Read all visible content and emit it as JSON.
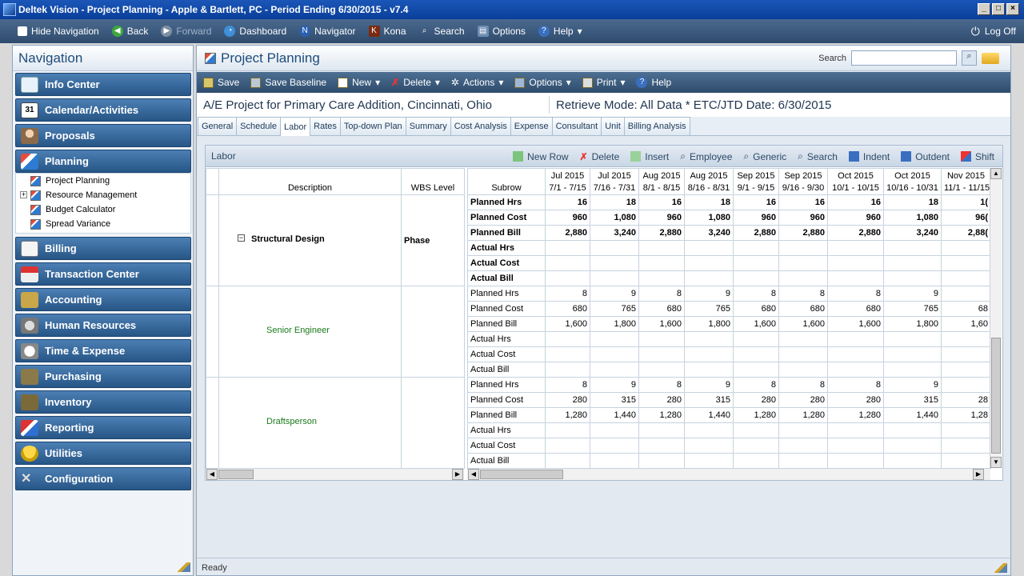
{
  "window": {
    "title": "Deltek Vision - Project Planning - Apple & Bartlett, PC - Period Ending 6/30/2015 - v7.4",
    "buttons": [
      "_",
      "□",
      "×"
    ]
  },
  "mainbar": {
    "hide_navigation": "Hide Navigation",
    "back": "Back",
    "forward": "Forward",
    "dashboard": "Dashboard",
    "navigator": "Navigator",
    "kona": "Kona",
    "search": "Search",
    "options": "Options",
    "help": "Help",
    "log_off": "Log Off"
  },
  "navigation": {
    "title": "Navigation",
    "items": [
      {
        "label": "Info Center",
        "icon": "info-center-icon"
      },
      {
        "label": "Calendar/Activities",
        "icon": "calendar-icon"
      },
      {
        "label": "Proposals",
        "icon": "proposals-icon"
      },
      {
        "label": "Planning",
        "icon": "planning-icon"
      },
      {
        "label": "Billing",
        "icon": "billing-icon"
      },
      {
        "label": "Transaction Center",
        "icon": "transaction-center-icon"
      },
      {
        "label": "Accounting",
        "icon": "accounting-icon"
      },
      {
        "label": "Human Resources",
        "icon": "human-resources-icon"
      },
      {
        "label": "Time & Expense",
        "icon": "time-expense-icon"
      },
      {
        "label": "Purchasing",
        "icon": "purchasing-icon"
      },
      {
        "label": "Inventory",
        "icon": "inventory-icon"
      },
      {
        "label": "Reporting",
        "icon": "reporting-icon"
      },
      {
        "label": "Utilities",
        "icon": "utilities-icon"
      },
      {
        "label": "Configuration",
        "icon": "configuration-icon"
      }
    ],
    "calendar_day": "31",
    "planning_subitems": [
      "Project Planning",
      "Resource Management",
      "Budget Calculator",
      "Spread Variance"
    ]
  },
  "page": {
    "title": "Project Planning",
    "search_label": "Search",
    "search_value": ""
  },
  "toolbar": {
    "save": "Save",
    "save_baseline": "Save Baseline",
    "new": "New",
    "delete": "Delete",
    "actions": "Actions",
    "options": "Options",
    "print": "Print",
    "help": "Help"
  },
  "project": {
    "name": "A/E Project for Primary Care Addition, Cincinnati, Ohio",
    "mode": "Retrieve Mode: All Data * ETC/JTD Date: 6/30/2015"
  },
  "tabs": [
    "General",
    "Schedule",
    "Labor",
    "Rates",
    "Top-down Plan",
    "Summary",
    "Cost Analysis",
    "Expense",
    "Consultant",
    "Unit",
    "Billing Analysis"
  ],
  "labor": {
    "title": "Labor",
    "tools": [
      "New Row",
      "Delete",
      "Insert",
      "Employee",
      "Generic",
      "Search",
      "Indent",
      "Outdent",
      "Shift"
    ],
    "left_headers": [
      "Description",
      "WBS Level"
    ],
    "rows": [
      {
        "description": "Structural Design",
        "wbs": "Phase"
      },
      {
        "description": "Senior Engineer",
        "wbs": ""
      },
      {
        "description": "Draftsperson",
        "wbs": ""
      }
    ],
    "right_headers": {
      "subrow": "Subrow",
      "periods": [
        [
          "Jul 2015",
          "7/1 - 7/15"
        ],
        [
          "Jul 2015",
          "7/16 - 7/31"
        ],
        [
          "Aug 2015",
          "8/1 - 8/15"
        ],
        [
          "Aug 2015",
          "8/16 - 8/31"
        ],
        [
          "Sep 2015",
          "9/1 - 9/15"
        ],
        [
          "Sep 2015",
          "9/16 - 9/30"
        ],
        [
          "Oct 2015",
          "10/1 - 10/15"
        ],
        [
          "Oct 2015",
          "10/16 - 10/31"
        ],
        [
          "Nov 2015",
          "11/1 - 11/15"
        ]
      ]
    },
    "subrows": [
      {
        "label": "Planned Hrs",
        "bold": true,
        "values": [
          "16",
          "18",
          "16",
          "18",
          "16",
          "16",
          "16",
          "18",
          "1("
        ]
      },
      {
        "label": "Planned Cost",
        "bold": true,
        "values": [
          "960",
          "1,080",
          "960",
          "1,080",
          "960",
          "960",
          "960",
          "1,080",
          "96("
        ]
      },
      {
        "label": "Planned Bill",
        "bold": true,
        "values": [
          "2,880",
          "3,240",
          "2,880",
          "3,240",
          "2,880",
          "2,880",
          "2,880",
          "3,240",
          "2,88("
        ]
      },
      {
        "label": "Actual Hrs",
        "bold": true,
        "values": [
          "",
          "",
          "",
          "",
          "",
          "",
          "",
          "",
          ""
        ]
      },
      {
        "label": "Actual Cost",
        "bold": true,
        "values": [
          "",
          "",
          "",
          "",
          "",
          "",
          "",
          "",
          ""
        ]
      },
      {
        "label": "Actual Bill",
        "bold": true,
        "values": [
          "",
          "",
          "",
          "",
          "",
          "",
          "",
          "",
          ""
        ]
      },
      {
        "label": "Planned Hrs",
        "bold": false,
        "values": [
          "8",
          "9",
          "8",
          "9",
          "8",
          "8",
          "8",
          "9",
          ""
        ]
      },
      {
        "label": "Planned Cost",
        "bold": false,
        "values": [
          "680",
          "765",
          "680",
          "765",
          "680",
          "680",
          "680",
          "765",
          "68"
        ]
      },
      {
        "label": "Planned Bill",
        "bold": false,
        "values": [
          "1,600",
          "1,800",
          "1,600",
          "1,800",
          "1,600",
          "1,600",
          "1,600",
          "1,800",
          "1,60"
        ]
      },
      {
        "label": "Actual Hrs",
        "bold": false,
        "values": [
          "",
          "",
          "",
          "",
          "",
          "",
          "",
          "",
          ""
        ]
      },
      {
        "label": "Actual Cost",
        "bold": false,
        "values": [
          "",
          "",
          "",
          "",
          "",
          "",
          "",
          "",
          ""
        ]
      },
      {
        "label": "Actual Bill",
        "bold": false,
        "values": [
          "",
          "",
          "",
          "",
          "",
          "",
          "",
          "",
          ""
        ]
      },
      {
        "label": "Planned Hrs",
        "bold": false,
        "values": [
          "8",
          "9",
          "8",
          "9",
          "8",
          "8",
          "8",
          "9",
          ""
        ]
      },
      {
        "label": "Planned Cost",
        "bold": false,
        "values": [
          "280",
          "315",
          "280",
          "315",
          "280",
          "280",
          "280",
          "315",
          "28"
        ]
      },
      {
        "label": "Planned Bill",
        "bold": false,
        "values": [
          "1,280",
          "1,440",
          "1,280",
          "1,440",
          "1,280",
          "1,280",
          "1,280",
          "1,440",
          "1,28"
        ]
      },
      {
        "label": "Actual Hrs",
        "bold": false,
        "values": [
          "",
          "",
          "",
          "",
          "",
          "",
          "",
          "",
          ""
        ]
      },
      {
        "label": "Actual Cost",
        "bold": false,
        "values": [
          "",
          "",
          "",
          "",
          "",
          "",
          "",
          "",
          ""
        ]
      },
      {
        "label": "Actual Bill",
        "bold": false,
        "values": [
          "",
          "",
          "",
          "",
          "",
          "",
          "",
          "",
          ""
        ]
      }
    ]
  },
  "status": {
    "text": "Ready"
  }
}
